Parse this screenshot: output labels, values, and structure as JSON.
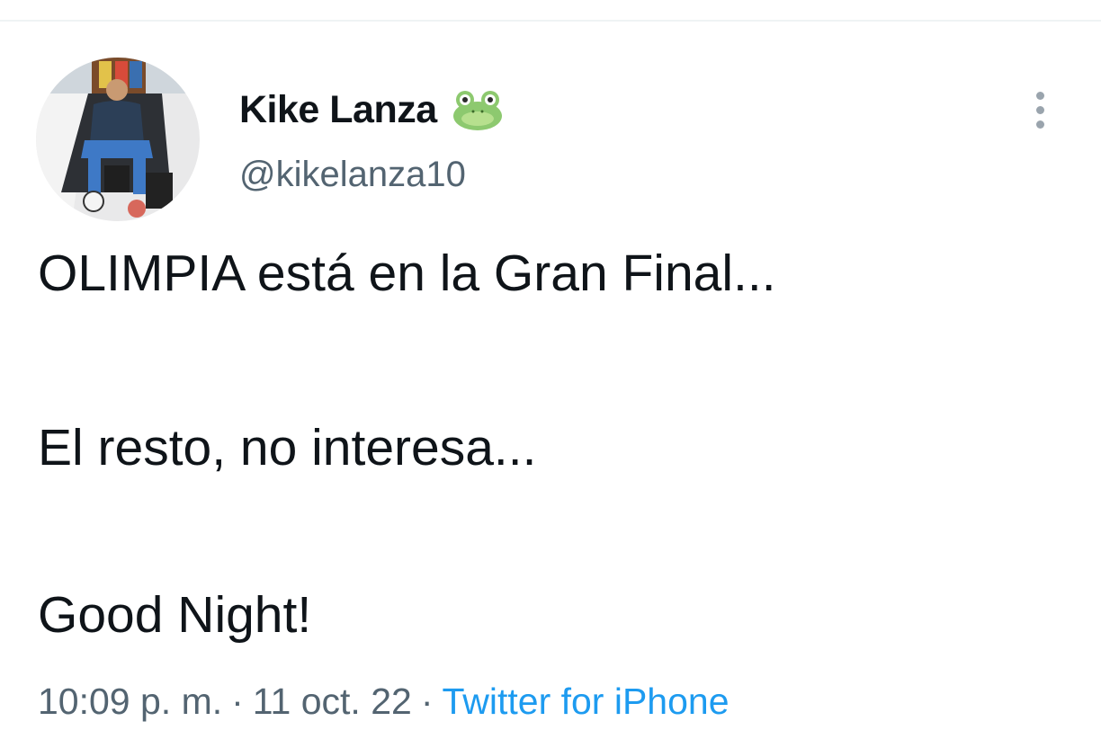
{
  "tweet": {
    "author": {
      "display_name": "Kike Lanza",
      "emoji_icon": "frog-face-icon",
      "handle": "@kikelanza10",
      "avatar_icon": "profile-photo"
    },
    "more_icon": "more-vertical-icon",
    "text_lines": [
      "OLIMPIA está en la Gran Final...",
      "El resto, no interesa...",
      "Good Night!"
    ],
    "time": "10:09 p. m.",
    "separator": "·",
    "date": "11 oct. 22",
    "source": "Twitter for iPhone"
  },
  "colors": {
    "text_primary": "#0f1419",
    "text_secondary": "#536471",
    "link": "#1d9bf0",
    "frog": "#8dc96f"
  }
}
